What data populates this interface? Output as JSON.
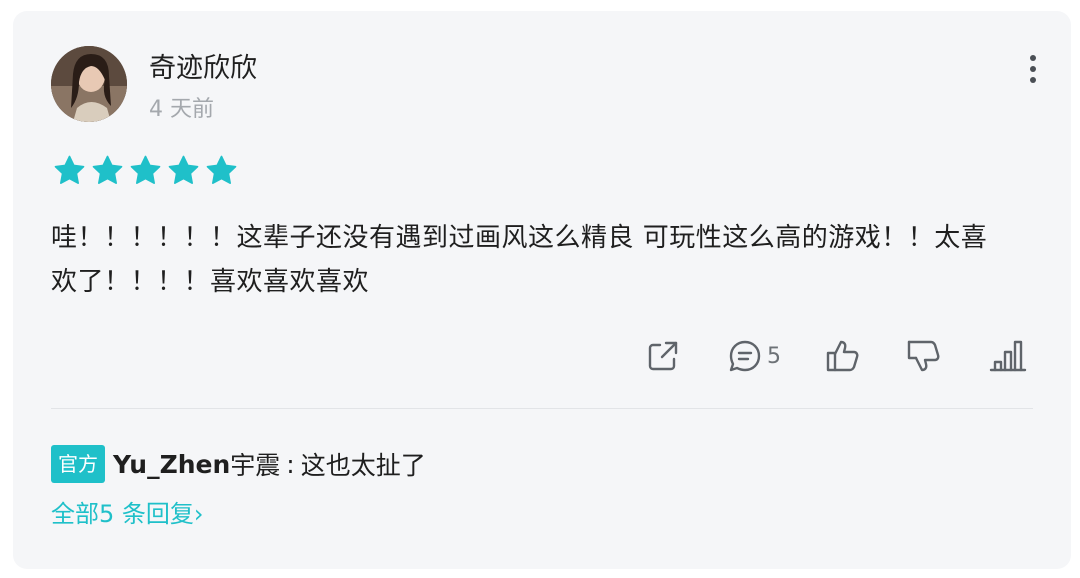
{
  "review": {
    "username": "奇迹欣欣",
    "time": "4 天前",
    "rating": 5,
    "rating_max": 5,
    "star_color": "#1fc0c9",
    "body": "哇！！！！！！这辈子还没有遇到过画风这么精良 可玩性这么高的游戏！！太喜欢了！！！！喜欢喜欢喜欢"
  },
  "actions": {
    "share_icon": "share-icon",
    "comment_icon": "comment-icon",
    "comment_count": "5",
    "like_icon": "thumbs-up-icon",
    "dislike_icon": "thumbs-down-icon",
    "stats_icon": "bar-chart-icon"
  },
  "reply": {
    "badge": "官方",
    "author": "Yu_Zhen",
    "author_suffix": "宇震",
    "separator": ":",
    "text": "这也太扯了"
  },
  "all_replies": "全部5 条回复",
  "colors": {
    "accent": "#1fc0c9",
    "card_bg": "#f5f6f8",
    "muted": "#a4a8ad"
  }
}
